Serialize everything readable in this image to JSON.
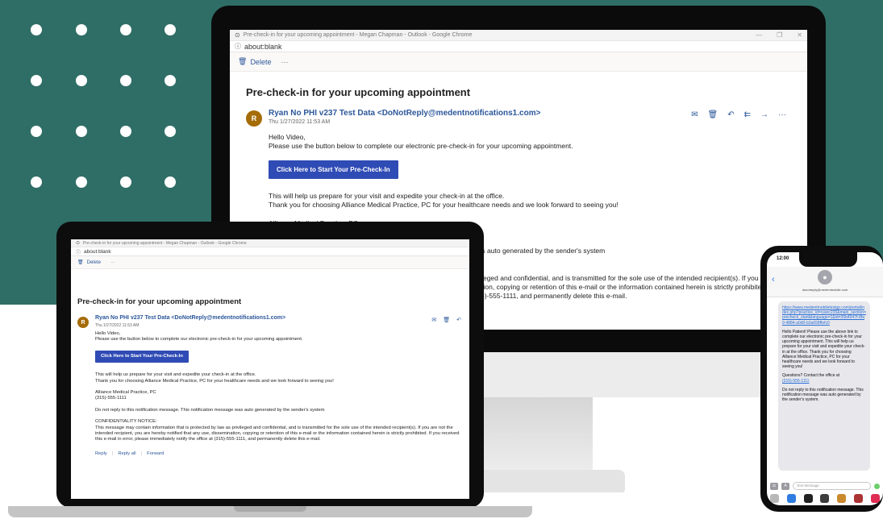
{
  "colors": {
    "background_teal": "#2f6e66",
    "accent_blue": "#2b579a",
    "button_blue": "#2f4bb5",
    "avatar_brown": "#a56c07"
  },
  "browser": {
    "window_title": "Pre-check-in for your upcoming appointment - Megan Chapman - Outlook - Google Chrome",
    "address_prefix": "ⓘ",
    "address": "about:blank",
    "delete_label": "Delete",
    "more_label": "···"
  },
  "email": {
    "subject": "Pre-check-in for your upcoming appointment",
    "avatar_initial": "R",
    "sender": "Ryan No PHI v237 Test Data <DoNotReply@medentnotifications1.com>",
    "date": "Thu 1/27/2022 11:53 AM",
    "greeting": "Hello Video,",
    "intro": "Please use the button below to complete our electronic pre-check-in for your upcoming appointment.",
    "button_label": "Click Here to Start Your Pre-Check-In",
    "help_line": "This will help us prepare for your visit and expedite your check-in at the office.",
    "thanks_line": "Thank you for choosing Alliance Medical Practice, PC for your healthcare needs and we look forward to seeing you!",
    "practice_name": "Alliance Medical Practice, PC",
    "practice_phone": "(315)-555-1111",
    "no_reply": "Do not reply to this notification message. This notification message was auto generated by the sender's system",
    "notice_title": "CONFIDENTIALITY NOTICE:",
    "notice_text": "This message may contain information that is protected by law as privileged and confidential, and is transmitted for the sole use of the intended recipient(s). If you are not the intended recipient, you are hereby notified that any use, dissemination, copying or retention of this e-mail or the information contained herein is strictly prohibited. If you received this e-mail in error, please immediately notify the office at (315)-555-1111, and permanently delete this e-mail.",
    "reply_label": "Reply",
    "reply_all_label": "Reply all",
    "forward_label": "Forward",
    "icons": [
      "envelope-icon",
      "trash-icon",
      "reply-icon",
      "reply-all-icon",
      "forward-icon",
      "more-icon"
    ]
  },
  "phone": {
    "time": "12:00",
    "contact": "donotreply@medentmobile.com",
    "link": "https://www.medentmobiletestgp.com/portal/index.php?practice_id=ryanc235&main_section=precheck_start&language=1&id=35b4947f-8fa9-4884-a0d0-b3a658ffefc0",
    "message": "Hello Patient!  Please use the above link to complete our electronic pre-check-in for your upcoming appointment.  This will help us prepare for your visit and expedite your check-in at the office.  Thank you for choosing Alliance Medical Practice, PC for your healthcare needs and we look forward to seeing you!",
    "questions": "Questions? Contact the office at",
    "questions_phone": "(315)-555-1111",
    "no_reply": "Do not reply to this notification message. This notification message was auto generated by the sender's system.",
    "input_placeholder": "Text Message"
  }
}
